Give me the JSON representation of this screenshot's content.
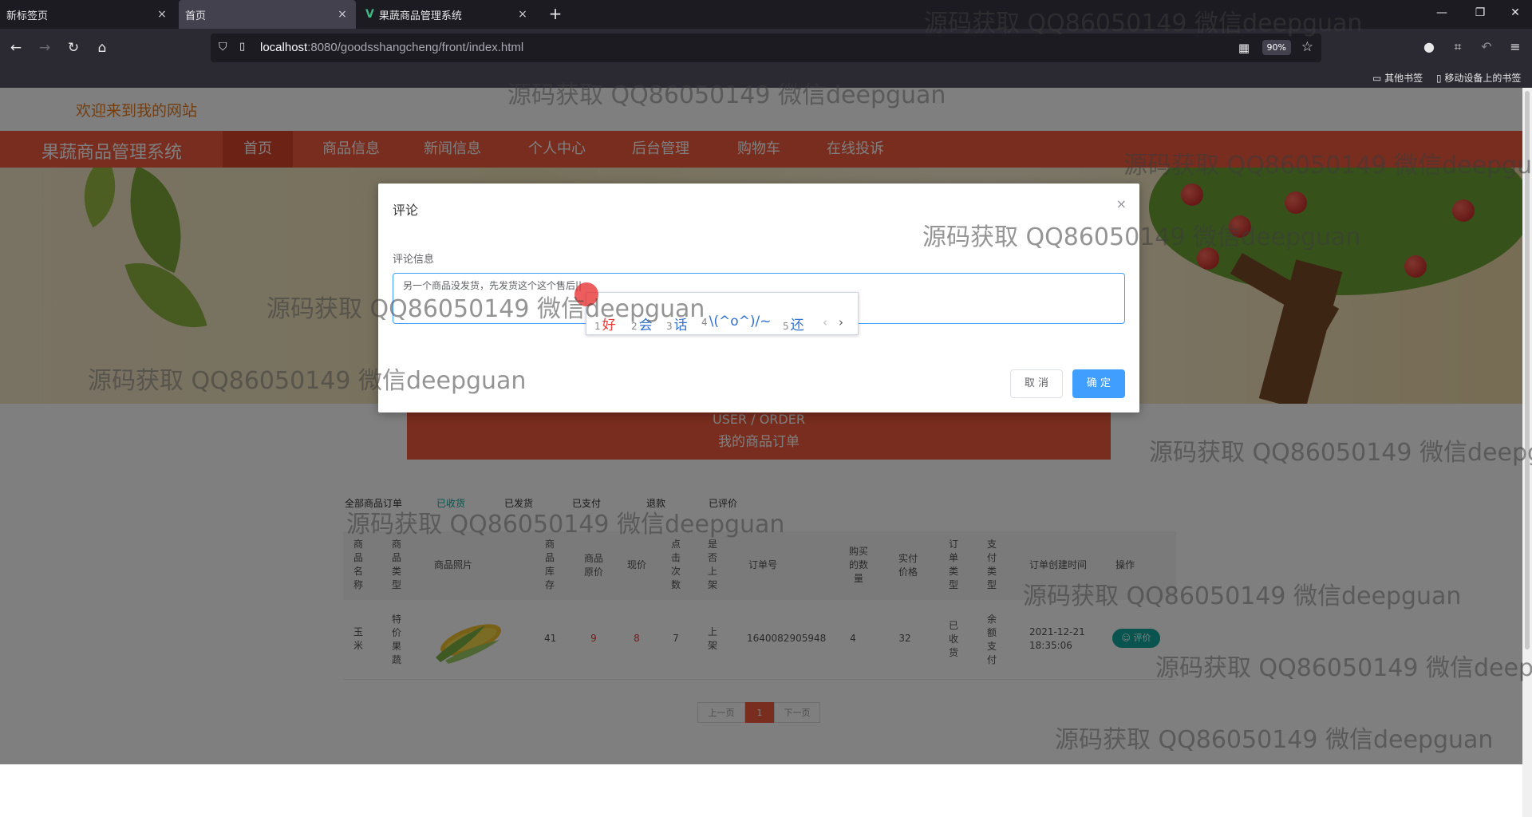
{
  "browser": {
    "tabs": [
      {
        "title": "新标签页",
        "close": "×"
      },
      {
        "title": "首页",
        "close": "×"
      },
      {
        "title": "果蔬商品管理系统",
        "close": "×"
      }
    ],
    "new_tab": "+",
    "window_controls": [
      "—",
      "❐",
      "✕"
    ],
    "url_host": "localhost",
    "url_rest": ":8080/goodsshangcheng/front/index.html",
    "zoom": "90%",
    "bookmarks": [
      "其他书签",
      "移动设备上的书签"
    ]
  },
  "site": {
    "welcome": "欢迎来到我的网站",
    "title": "果蔬商品管理系统",
    "nav": [
      "首页",
      "商品信息",
      "新闻信息",
      "个人中心",
      "后台管理",
      "购物车",
      "在线投诉"
    ],
    "order_header_en": "USER / ORDER",
    "order_header_cn": "我的商品订单",
    "filters": [
      "全部商品订单",
      "已收货",
      "已发货",
      "已支付",
      "退款",
      "已评价"
    ],
    "columns": [
      "商品名称",
      "商品类型",
      "商品照片",
      "商品库存",
      "商品原价",
      "现价",
      "点击次数",
      "是否上架",
      "订单号",
      "购买的数量",
      "实付价格",
      "订单类型",
      "支付类型",
      "订单创建时间",
      "操作"
    ],
    "row": {
      "name": "玉米",
      "type": "特价果蔬",
      "stock": "41",
      "original_price": "9",
      "price": "8",
      "clicks": "7",
      "on_shelf": "上架",
      "order_no": "1640082905948",
      "quantity": "4",
      "paid": "32",
      "order_type": "已收货",
      "pay_type": "余额支付",
      "created_date": "2021-12-21",
      "created_time": "18:35:06",
      "action": "评价"
    },
    "pager": {
      "prev": "上一页",
      "current": "1",
      "next": "下一页"
    }
  },
  "modal": {
    "title": "评论",
    "close": "×",
    "label": "评论信息",
    "value": "另一个商品没发货，先发货这个这个售后||",
    "ime_candidates": [
      {
        "n": "1",
        "t": "好"
      },
      {
        "n": "2",
        "t": "会"
      },
      {
        "n": "3",
        "t": "话"
      },
      {
        "n": "4",
        "t": "\\(^o^)/~"
      },
      {
        "n": "5",
        "t": "还"
      }
    ],
    "ime_prev": "‹",
    "ime_next": "›",
    "cancel": "取 消",
    "confirm": "确 定"
  },
  "watermark": "源码获取 QQ86050149 微信deepguan",
  "colors": {
    "accent": "#f05a3c",
    "primary": "#409eff",
    "teal": "#13a89e"
  }
}
